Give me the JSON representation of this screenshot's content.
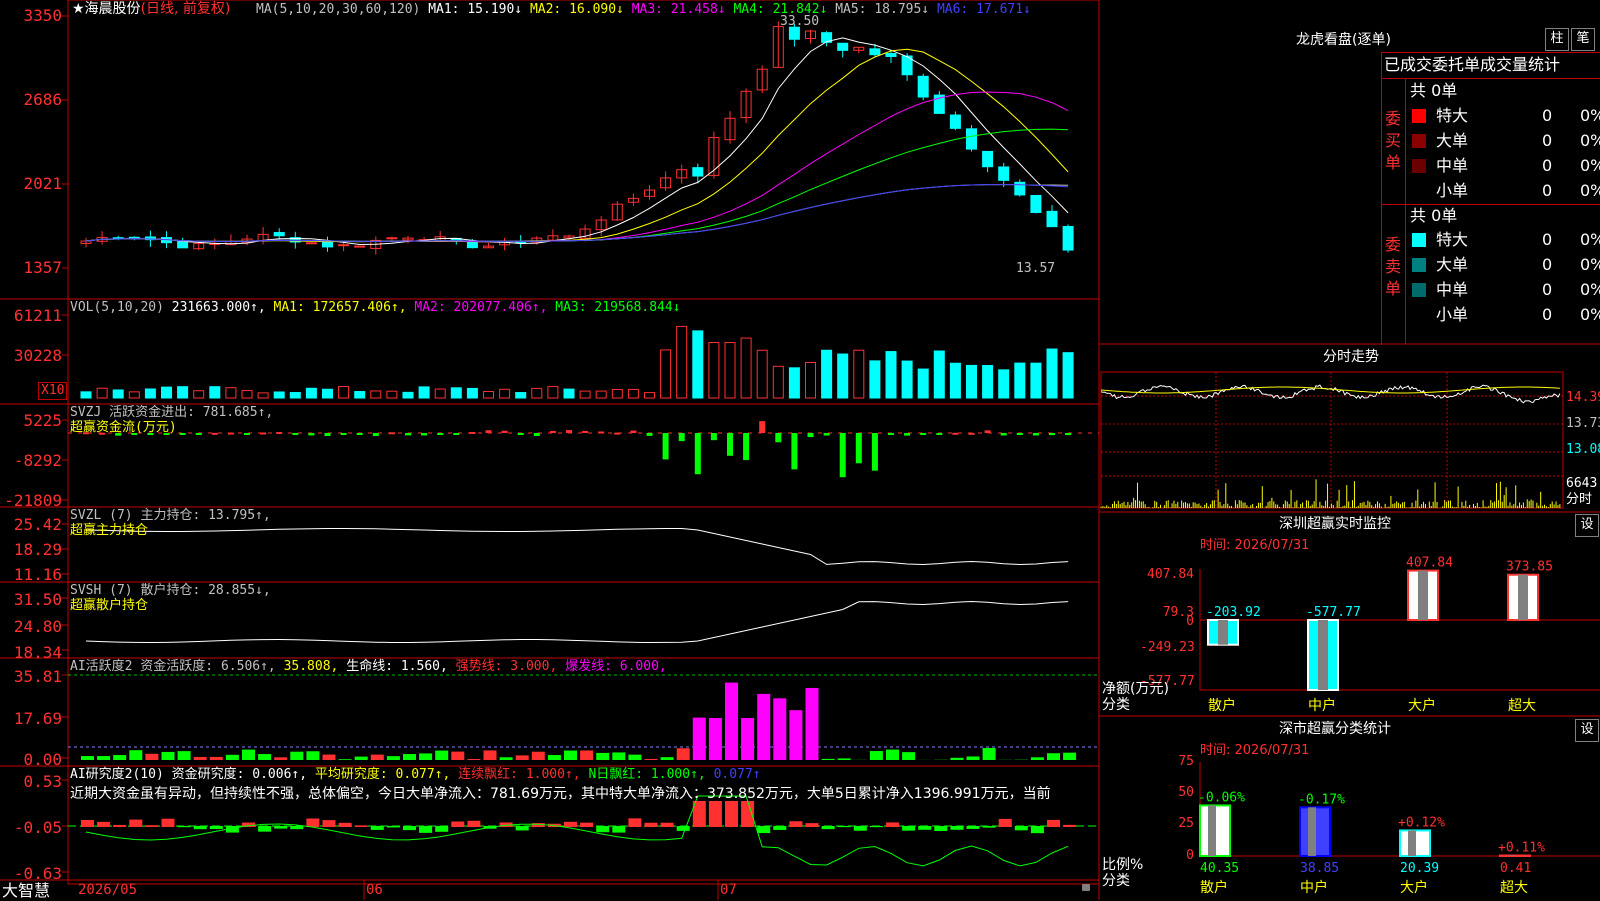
{
  "kline": {
    "title": "★海晨股份",
    "mode": "(日线, 前复权)",
    "ma_label": "MA(5,10,20,30,60,120)",
    "ma_values": [
      {
        "label": "MA1: 15.190↓",
        "color": "#ffffff"
      },
      {
        "label": "MA2: 16.090↓",
        "color": "#ffff00"
      },
      {
        "label": "MA3: 21.458↓",
        "color": "#ff00ff"
      },
      {
        "label": "MA4: 21.842↓",
        "color": "#00ff00"
      },
      {
        "label": "MA5: 18.795↓",
        "color": "#c0c0c0"
      },
      {
        "label": "MA6: 17.671↓",
        "color": "#4040ff"
      }
    ],
    "y_ticks": [
      "3350",
      "2686",
      "2021",
      "1357"
    ],
    "high_label": "33.50",
    "low_label": "13.57"
  },
  "vol": {
    "label": "VOL(5,10,20)",
    "value": "231663.000↑,",
    "ma1": "MA1: 172657.406↑,",
    "ma2": "MA2: 202077.406↑,",
    "ma3": "MA3: 219568.844↓",
    "y_ticks": [
      "61211",
      "30228"
    ],
    "scale": "X10"
  },
  "svzj": {
    "label": "SVZJ  活跃资金进出: 781.685↑,",
    "sub": "超赢资金流(万元)",
    "y_ticks": [
      "5225",
      "-8292",
      "-21809"
    ]
  },
  "svzl": {
    "label": "SVZL (7) 主力持仓: 13.795↑,",
    "sub": "超赢主力持仓",
    "y_ticks": [
      "25.42",
      "18.29",
      "11.16"
    ]
  },
  "svsh": {
    "label": "SVSH (7) 散户持仓: 28.855↓,",
    "sub": "超赢散户持仓",
    "y_ticks": [
      "31.50",
      "24.80",
      "18.34"
    ]
  },
  "ai1": {
    "label": "AI活跃度2 资金活跃度: 6.506↑,",
    "v2": "35.808,",
    "v3": "生命线: 1.560,",
    "v4": "强势线: 3.000,",
    "v5": "爆发线: 6.000,",
    "y_ticks": [
      "35.81",
      "17.69",
      "0.00"
    ]
  },
  "ai2": {
    "label": "AI研究度2(10) 资金研究度: 0.006↑,",
    "v2": "平均研究度: 0.077↑,",
    "v3": "连续飘红: 1.000↑,",
    "v4": "N日飘红: 1.000↑,",
    "v5": "0.077↑",
    "note": "近期大资金虽有异动，但持续性不强，总体偏空，今日大单净流入：781.69万元，其中特大单净流入：373.852万元，大单5日累计净入1396.991万元，当前",
    "y_ticks": [
      "0.53",
      "-0.05",
      "-0.63"
    ]
  },
  "xaxis": {
    "labels": [
      "2026/05",
      "06",
      "07"
    ],
    "brand": "大智慧"
  },
  "lhb": {
    "title": "龙虎看盘(逐单)",
    "btn1": "柱",
    "btn2": "笔",
    "header": "已成交委托单成交量统计",
    "buy_label": "委买单",
    "sell_label": "委卖单",
    "buy_total": "共 0单",
    "sell_total": "共 0单",
    "buy_rows": [
      {
        "name": "特大",
        "v": "0",
        "p": "0%",
        "color": "#ff0000"
      },
      {
        "name": "大单",
        "v": "0",
        "p": "0%",
        "color": "#8b0000"
      },
      {
        "name": "中单",
        "v": "0",
        "p": "0%",
        "color": "#6b0000"
      },
      {
        "name": "小单",
        "v": "0",
        "p": "0%",
        "color": ""
      }
    ],
    "sell_rows": [
      {
        "name": "特大",
        "v": "0",
        "p": "0%",
        "color": "#00ffff"
      },
      {
        "name": "大单",
        "v": "0",
        "p": "0%",
        "color": "#008080"
      },
      {
        "name": "中单",
        "v": "0",
        "p": "0%",
        "color": "#006b6b"
      },
      {
        "name": "小单",
        "v": "0",
        "p": "0%",
        "color": ""
      }
    ]
  },
  "fenshi": {
    "title": "分时走势",
    "y_ticks": [
      "14.39",
      "13.73",
      "13.08"
    ],
    "vol_label": "6643",
    "vol_unit": "分时"
  },
  "monitor": {
    "title": "深圳超赢实时监控",
    "btn": "设",
    "time": "时间: 2026/07/31",
    "y_ticks": [
      "407.84",
      "79.3",
      "0",
      "-249.23",
      "-577.77"
    ],
    "ylabel1": "净额(万元)",
    "ylabel2": "分类",
    "bars": [
      {
        "cat": "散户",
        "value": -203.92,
        "label": "-203.92"
      },
      {
        "cat": "中户",
        "value": -577.77,
        "label": "-577.77"
      },
      {
        "cat": "大户",
        "value": 407.84,
        "label": "407.84"
      },
      {
        "cat": "超大",
        "value": 373.85,
        "label": "373.85"
      }
    ]
  },
  "stats": {
    "title": "深市超赢分类统计",
    "btn": "设",
    "time": "时间: 2026/07/31",
    "y_ticks": [
      "75",
      "50",
      "25",
      "0"
    ],
    "ylabel1": "比例%",
    "ylabel2": "分类",
    "bars": [
      {
        "cat": "散户",
        "value": 40.35,
        "label": "40.35",
        "change": "-0.06%"
      },
      {
        "cat": "中户",
        "value": 38.85,
        "label": "38.85",
        "change": "-0.17%"
      },
      {
        "cat": "大户",
        "value": 20.39,
        "label": "20.39",
        "change": "+0.12%"
      },
      {
        "cat": "超大",
        "value": 0.41,
        "label": "0.41",
        "change": "+0.11%"
      }
    ]
  }
}
